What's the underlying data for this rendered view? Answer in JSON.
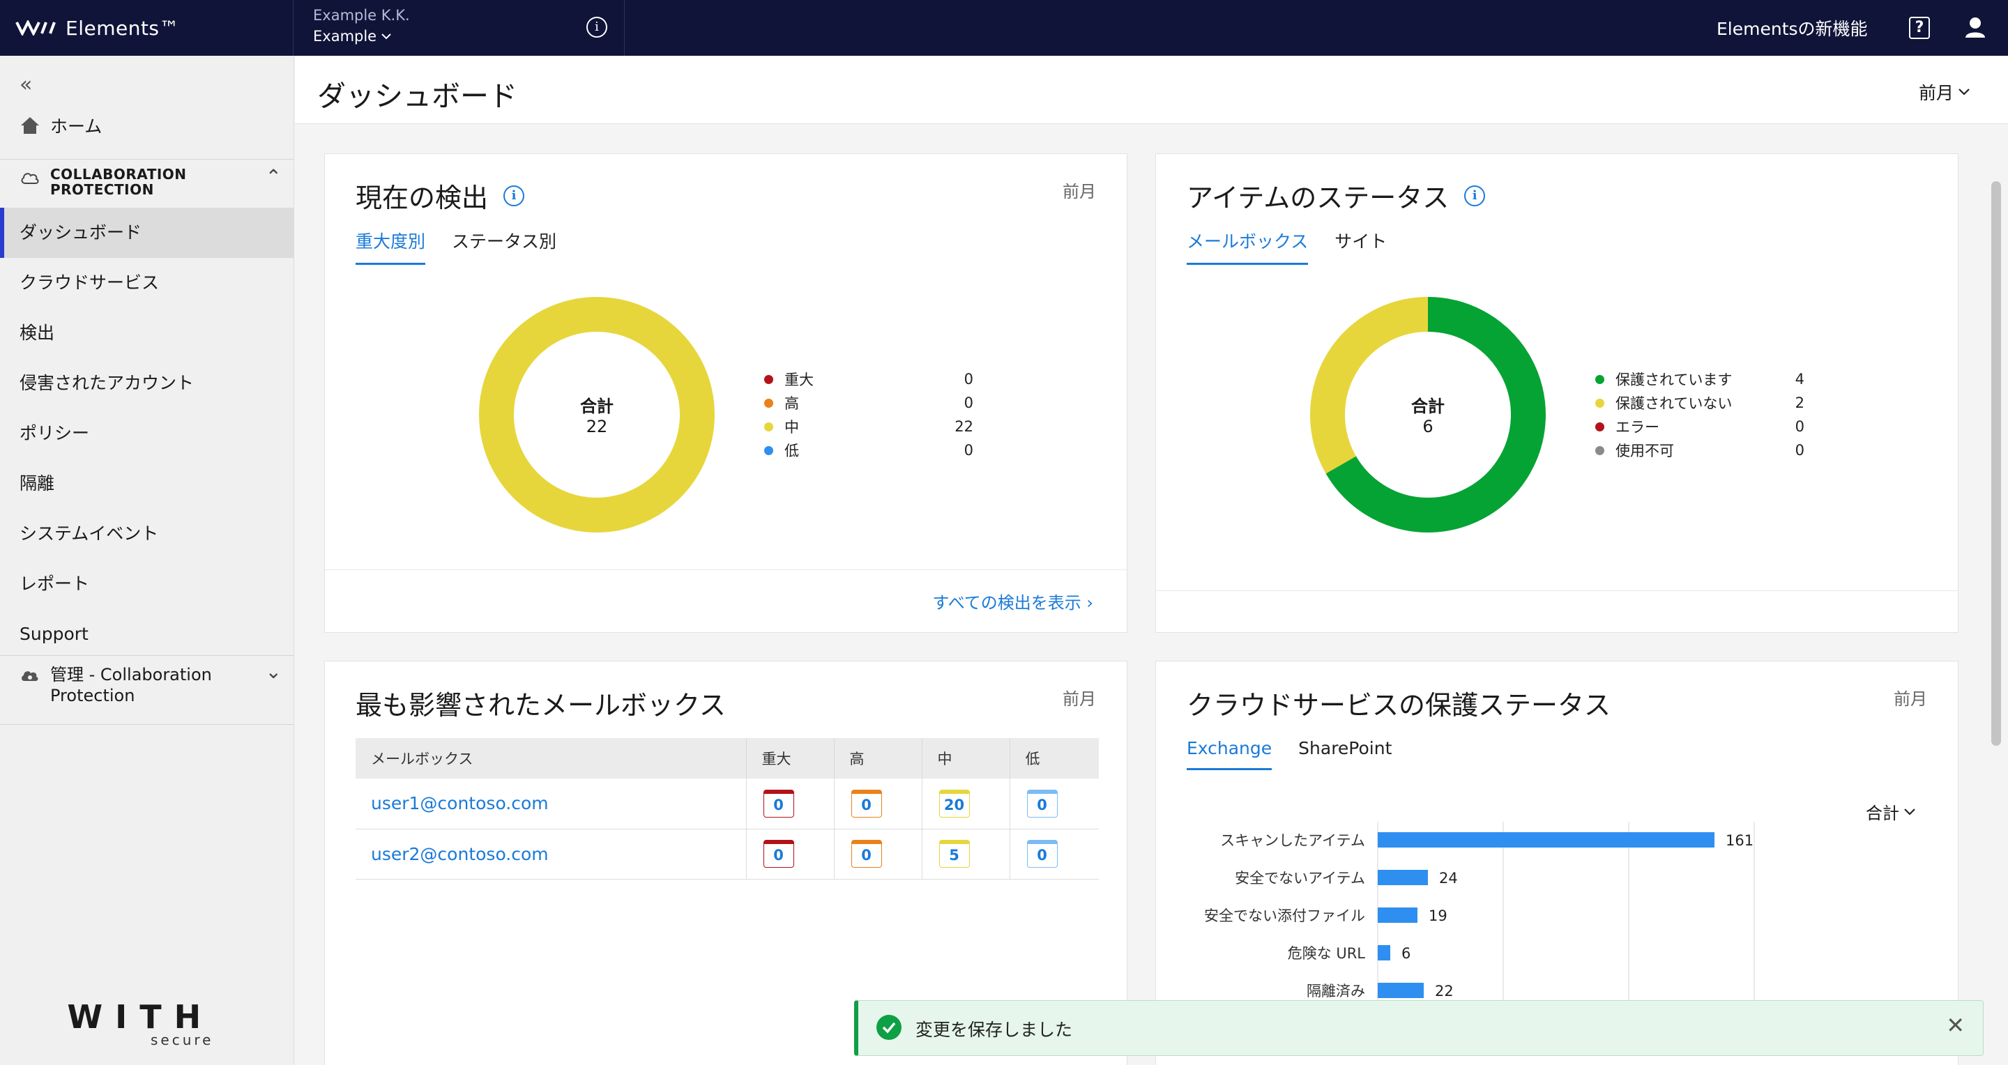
{
  "topbar": {
    "brand": "Elements™",
    "org_name": "Example K.K.",
    "org_sub": "Example",
    "whats_new": "Elementsの新機能"
  },
  "sidebar": {
    "home": "ホーム",
    "section_label": "COLLABORATION PROTECTION",
    "items": [
      {
        "label": "ダッシュボード",
        "active": true
      },
      {
        "label": "クラウドサービス"
      },
      {
        "label": "検出"
      },
      {
        "label": "侵害されたアカウント"
      },
      {
        "label": "ポリシー"
      },
      {
        "label": "隔離"
      },
      {
        "label": "システムイベント"
      },
      {
        "label": "レポート"
      },
      {
        "label": "Support"
      }
    ],
    "mgmt_label": "管理 - Collaboration Protection",
    "logo_big": "WITH",
    "logo_small": "secure"
  },
  "page": {
    "title": "ダッシュボード",
    "period": "前月"
  },
  "detections_card": {
    "title": "現在の検出",
    "period": "前月",
    "tabs": [
      "重大度別",
      "ステータス別"
    ],
    "center_label": "合計",
    "center_value": "22",
    "legend": [
      {
        "label": "重大",
        "value": "0",
        "color": "#b3121a"
      },
      {
        "label": "高",
        "value": "0",
        "color": "#e9821b"
      },
      {
        "label": "中",
        "value": "22",
        "color": "#e6d63c"
      },
      {
        "label": "低",
        "value": "0",
        "color": "#2e8ff0"
      }
    ],
    "view_all": "すべての検出を表示"
  },
  "status_card": {
    "title": "アイテムのステータス",
    "tabs": [
      "メールボックス",
      "サイト"
    ],
    "center_label": "合計",
    "center_value": "6",
    "legend": [
      {
        "label": "保護されています",
        "value": "4",
        "color": "#05a334"
      },
      {
        "label": "保護されていない",
        "value": "2",
        "color": "#e6d63c"
      },
      {
        "label": "エラー",
        "value": "0",
        "color": "#b3121a"
      },
      {
        "label": "使用不可",
        "value": "0",
        "color": "#8a8a8a"
      }
    ]
  },
  "mailbox_card": {
    "title": "最も影響されたメールボックス",
    "period": "前月",
    "columns": [
      "メールボックス",
      "重大",
      "高",
      "中",
      "低"
    ],
    "rows": [
      {
        "mailbox": "user1@contoso.com",
        "critical": "0",
        "high": "0",
        "medium": "20",
        "low": "0"
      },
      {
        "mailbox": "user2@contoso.com",
        "critical": "0",
        "high": "0",
        "medium": "5",
        "low": "0"
      }
    ],
    "severity_colors": [
      "#b3121a",
      "#e9821b",
      "#e6d63c",
      "#7cbcf5"
    ]
  },
  "protection_card": {
    "title": "クラウドサービスの保護ステータス",
    "period": "前月",
    "tabs": [
      "Exchange",
      "SharePoint"
    ],
    "filter": "合計",
    "bar_color": "#2e8ff0"
  },
  "chart_data": {
    "type": "bar",
    "orientation": "horizontal",
    "categories": [
      "スキャンしたアイテム",
      "安全でないアイテム",
      "安全でない添付ファイル",
      "危険な URL",
      "隔離済み"
    ],
    "values": [
      161,
      24,
      19,
      6,
      22
    ],
    "xlim": [
      0,
      180
    ],
    "grid": true
  },
  "toast": {
    "message": "変更を保存しました"
  }
}
